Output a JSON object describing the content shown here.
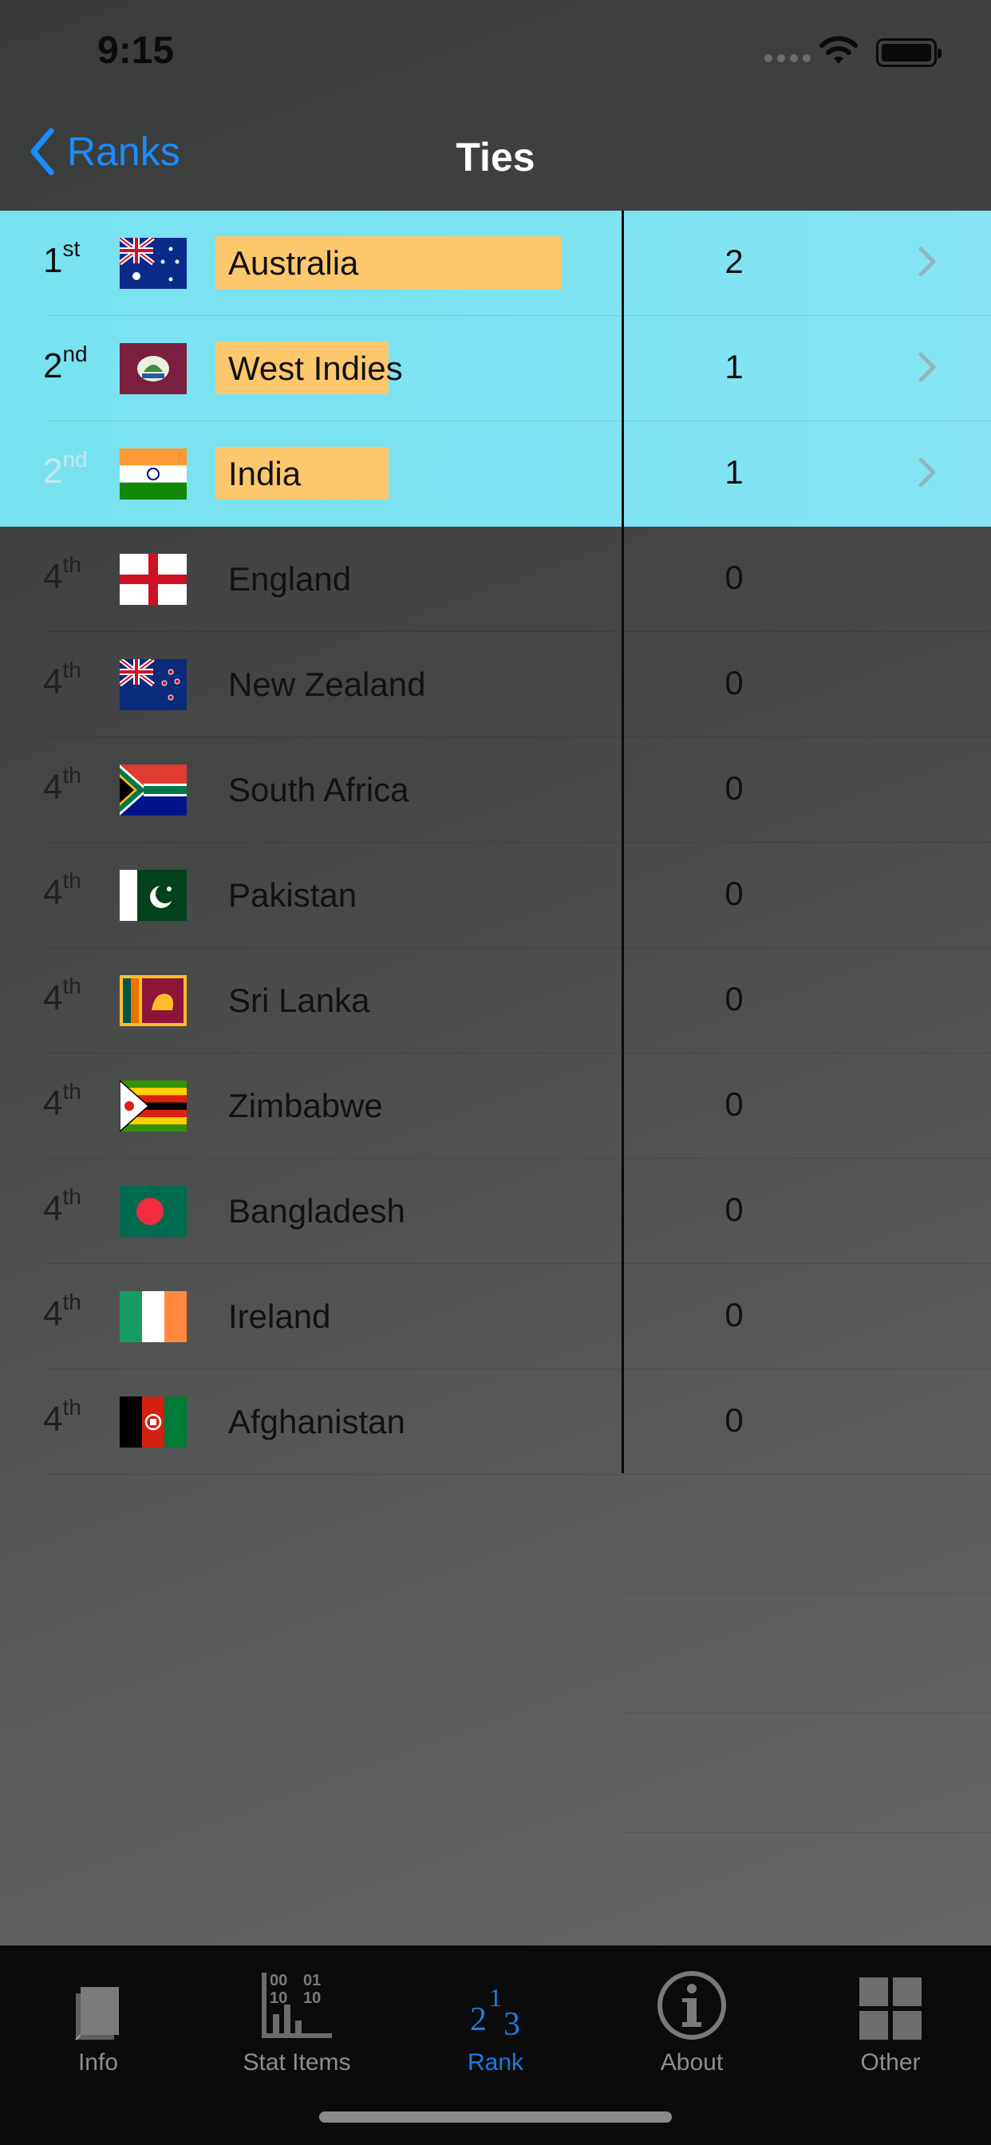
{
  "status": {
    "time": "9:15"
  },
  "nav": {
    "back_label": "Ranks",
    "title": "Ties"
  },
  "rows": [
    {
      "rank": "1",
      "suffix": "st",
      "country": "Australia",
      "value": "2",
      "flag": "australia-flag"
    },
    {
      "rank": "2",
      "suffix": "nd",
      "country": "West Indies",
      "value": "1",
      "flag": "west-indies-flag"
    },
    {
      "rank": "2",
      "suffix": "nd",
      "country": "India",
      "value": "1",
      "flag": "india-flag"
    },
    {
      "rank": "4",
      "suffix": "th",
      "country": "England",
      "value": "0",
      "flag": "england-flag"
    },
    {
      "rank": "4",
      "suffix": "th",
      "country": "New Zealand",
      "value": "0",
      "flag": "new-zealand-flag"
    },
    {
      "rank": "4",
      "suffix": "th",
      "country": "South Africa",
      "value": "0",
      "flag": "south-africa-flag"
    },
    {
      "rank": "4",
      "suffix": "th",
      "country": "Pakistan",
      "value": "0",
      "flag": "pakistan-flag"
    },
    {
      "rank": "4",
      "suffix": "th",
      "country": "Sri Lanka",
      "value": "0",
      "flag": "sri-lanka-flag"
    },
    {
      "rank": "4",
      "suffix": "th",
      "country": "Zimbabwe",
      "value": "0",
      "flag": "zimbabwe-flag"
    },
    {
      "rank": "4",
      "suffix": "th",
      "country": "Bangladesh",
      "value": "0",
      "flag": "bangladesh-flag"
    },
    {
      "rank": "4",
      "suffix": "th",
      "country": "Ireland",
      "value": "0",
      "flag": "ireland-flag"
    },
    {
      "rank": "4",
      "suffix": "th",
      "country": "Afghanistan",
      "value": "0",
      "flag": "afghanistan-flag"
    }
  ],
  "tabs": [
    {
      "label": "Info",
      "icon": "book-icon"
    },
    {
      "label": "Stat Items",
      "icon": "stat-items-icon",
      "icon_text": [
        "00",
        "01",
        "10",
        "10"
      ]
    },
    {
      "label": "Rank",
      "icon": "rank-icon",
      "icon_text": [
        "2",
        "1",
        "3"
      ]
    },
    {
      "label": "About",
      "icon": "info-circle-icon"
    },
    {
      "label": "Other",
      "icon": "grid-icon"
    }
  ],
  "colors": {
    "accent": "#1a8cff",
    "highlight_row": "#7fe3f2",
    "name_bar": "#fdc86d",
    "tab_active": "#1f7ae0",
    "tab_inactive": "#8e8e8e"
  }
}
